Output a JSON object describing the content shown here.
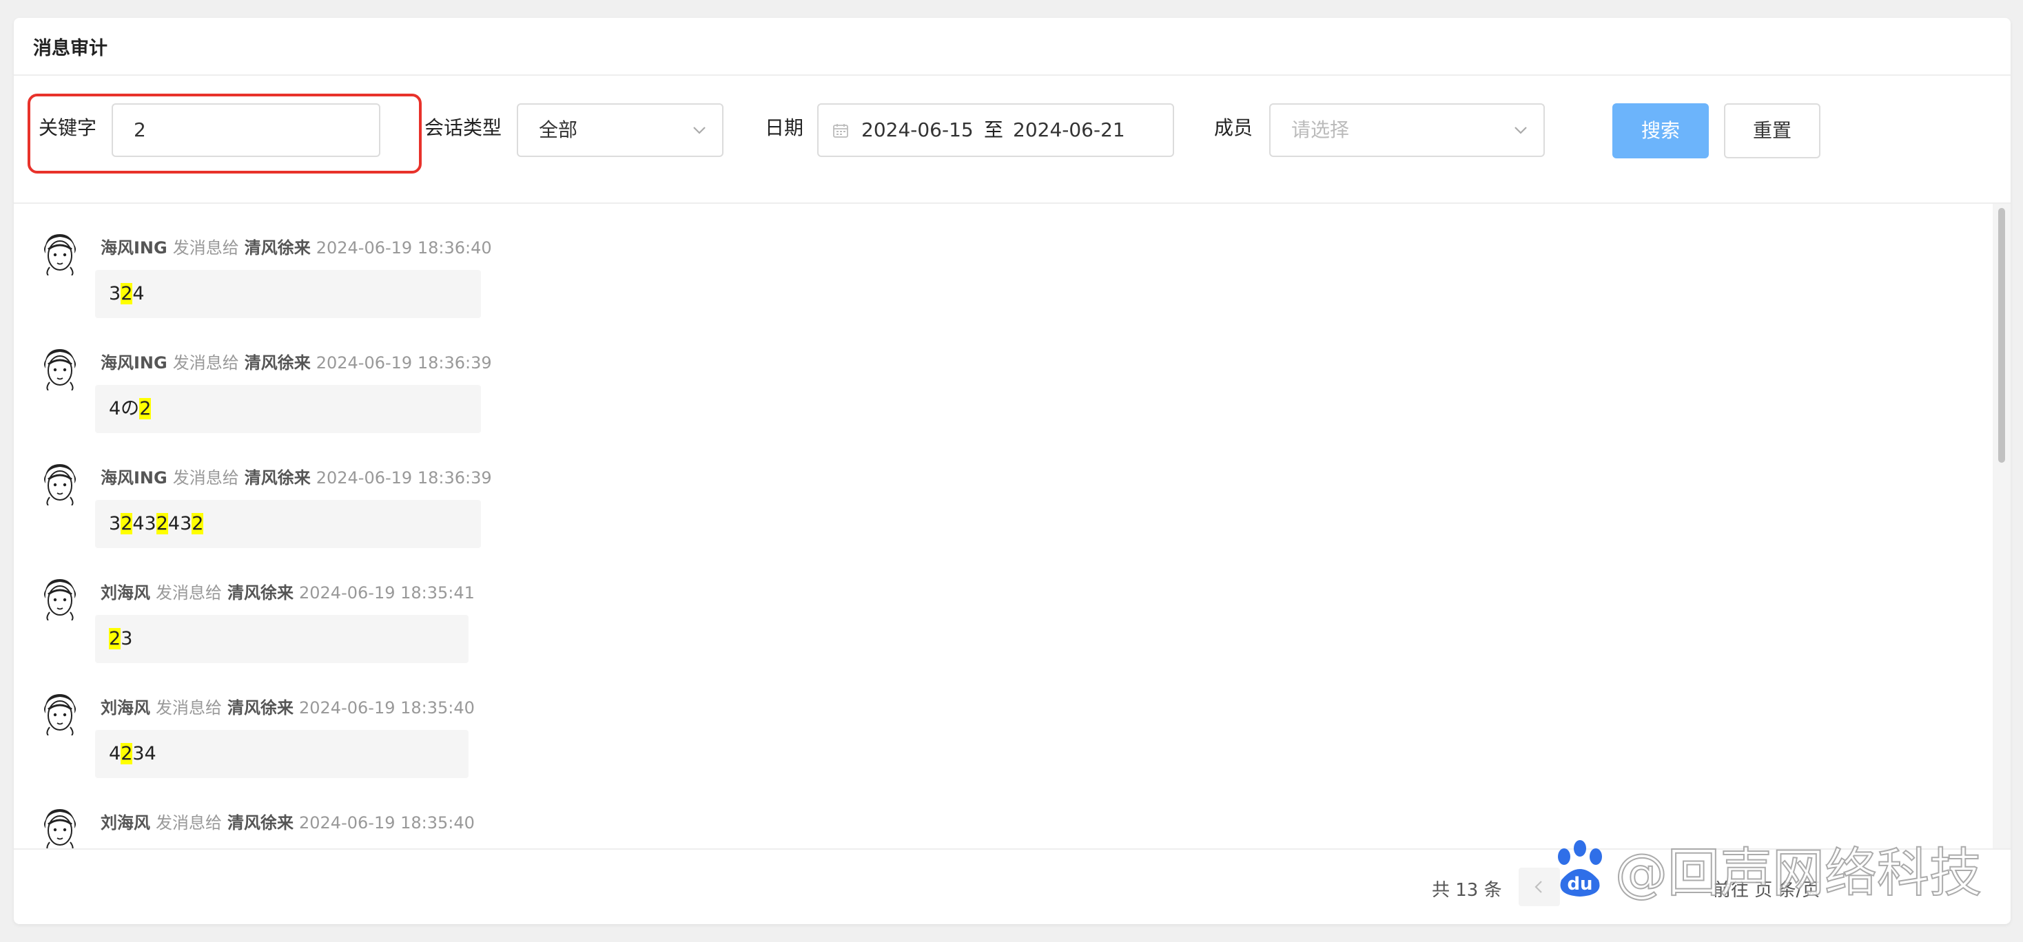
{
  "title": "消息审计",
  "filters": {
    "keyword_label": "关键字",
    "keyword_value": "2",
    "type_label": "会话类型",
    "type_value": "全部",
    "date_label": "日期",
    "date_start": "2024-06-15",
    "date_sep": "至",
    "date_end": "2024-06-21",
    "member_label": "成员",
    "member_placeholder": "请选择",
    "search_label": "搜索",
    "reset_label": "重置"
  },
  "messages": [
    {
      "sender": "海风ING",
      "verb": "发消息给",
      "receiver": "清风徐来",
      "time": "2024-06-19 18:36:40",
      "text": "324"
    },
    {
      "sender": "海风ING",
      "verb": "发消息给",
      "receiver": "清风徐来",
      "time": "2024-06-19 18:36:39",
      "text": "4の2"
    },
    {
      "sender": "海风ING",
      "verb": "发消息给",
      "receiver": "清风徐来",
      "time": "2024-06-19 18:36:39",
      "text": "32432432"
    },
    {
      "sender": "刘海风",
      "verb": "发消息给",
      "receiver": "清风徐来",
      "time": "2024-06-19 18:35:41",
      "text": "23"
    },
    {
      "sender": "刘海风",
      "verb": "发消息给",
      "receiver": "清风徐来",
      "time": "2024-06-19 18:35:40",
      "text": "4234"
    },
    {
      "sender": "刘海风",
      "verb": "发消息给",
      "receiver": "清风徐来",
      "time": "2024-06-19 18:35:40",
      "text": ""
    }
  ],
  "footer": {
    "total": "共 13 条",
    "prev_icon": "chevron-left-icon",
    "page_text": "前往 页 条/页"
  },
  "watermark": {
    "text": "@回声网络科技"
  },
  "colors": {
    "primary_button": "#6cb4fb",
    "highlight_box": "#e8322b",
    "keyword_highlight": "#ffff00"
  }
}
